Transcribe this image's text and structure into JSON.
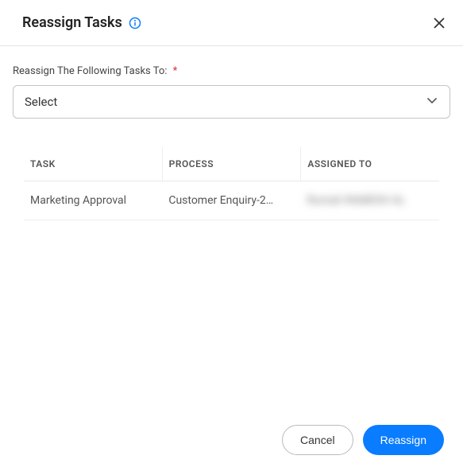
{
  "header": {
    "title": "Reassign Tasks"
  },
  "form": {
    "reassign_label": "Reassign The Following Tasks To:",
    "select_placeholder": "Select"
  },
  "table": {
    "headers": {
      "task": "TASK",
      "process": "PROCESS",
      "assigned_to": "ASSIGNED TO"
    },
    "rows": [
      {
        "task": "Marketing Approval",
        "process": "Customer Enquiry-2…",
        "assigned_to": "Rumah RAMESH AL"
      }
    ]
  },
  "footer": {
    "cancel_label": "Cancel",
    "reassign_label": "Reassign"
  }
}
